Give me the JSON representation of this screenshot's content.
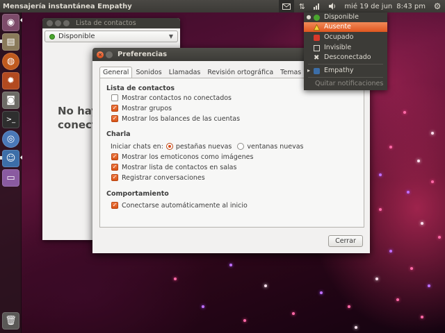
{
  "top_panel": {
    "app_title": "Mensajería instantánea Empathy",
    "clock_date": "mié 19 de jun",
    "clock_time": "8:43 pm",
    "tray_icons": [
      "mail-icon",
      "volume-icon",
      "network-icon",
      "sound-icon",
      "gear-icon"
    ]
  },
  "launcher": {
    "items": [
      "ubuntu-logo-icon",
      "files-icon",
      "firefox-icon",
      "settings-icon",
      "camera-icon",
      "terminal-icon",
      "chromium-icon",
      "empathy-icon",
      "window-icon",
      "trash-icon"
    ]
  },
  "contacts_window": {
    "title": "Lista de contactos",
    "status": "Disponible",
    "message_line1": "No hay",
    "message_line2": "conect"
  },
  "preferences": {
    "title": "Preferencias",
    "tabs": [
      {
        "label": "General"
      },
      {
        "label": "Sonidos"
      },
      {
        "label": "Llamadas"
      },
      {
        "label": "Revisión ortográfica"
      },
      {
        "label": "Temas"
      }
    ],
    "sections": {
      "contacts": {
        "title": "Lista de contactos",
        "options": [
          {
            "label": "Mostrar contactos no conectados",
            "checked": false
          },
          {
            "label": "Mostrar grupos",
            "checked": true
          },
          {
            "label": "Mostrar los balances de las cuentas",
            "checked": true
          }
        ]
      },
      "chat": {
        "title": "Charla",
        "open_in_label": "Iniciar chats en:",
        "radio_tabs": "pestañas nuevas",
        "radio_windows": "ventanas nuevas",
        "options": [
          {
            "label": "Mostrar los emoticonos como imágenes",
            "checked": true
          },
          {
            "label": "Mostrar lista de contactos en salas",
            "checked": true
          },
          {
            "label": "Registrar conversaciones",
            "checked": true
          }
        ]
      },
      "behavior": {
        "title": "Comportamiento",
        "options": [
          {
            "label": "Conectarse automáticamente al inicio",
            "checked": true
          }
        ]
      }
    },
    "close_label": "Cerrar"
  },
  "messaging_menu": {
    "items": [
      {
        "label": "Disponible",
        "icon": "available-icon"
      },
      {
        "label": "Ausente",
        "icon": "away-icon"
      },
      {
        "label": "Ocupado",
        "icon": "busy-icon"
      },
      {
        "label": "Invisible",
        "icon": "invisible-icon"
      },
      {
        "label": "Desconectado",
        "icon": "offline-icon"
      },
      {
        "label": "Empathy",
        "icon": "empathy-icon"
      },
      {
        "label": "Quitar notificaciones"
      }
    ]
  },
  "colors": {
    "accent": "#df4a16",
    "panel": "#3c3b37",
    "available": "#4aa52e"
  }
}
